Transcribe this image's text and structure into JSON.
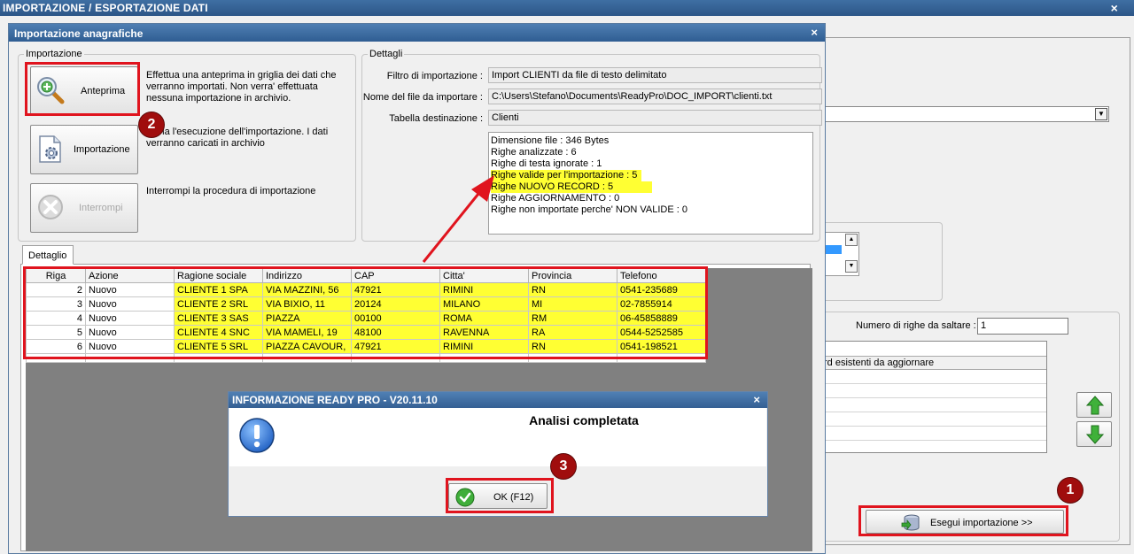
{
  "main_window": {
    "title": "IMPORTAZIONE / ESPORTAZIONE DATI",
    "skip_rows_label": "Numero di righe da saltare  :",
    "skip_rows_value": "1",
    "update_records_header": "rd esistenti da aggiornare",
    "execute_button_label": "Esegui importazione >>"
  },
  "dialog": {
    "title": "Importazione anagrafiche",
    "import_group_label": "Importazione",
    "preview_button_label": "Anteprima",
    "preview_description": "Effettua una anteprima in griglia dei dati che verranno importati. Non verra' effettuata nessuna importazione in archivio.",
    "import_button_label": "Importazione",
    "import_description": "Avvia l'esecuzione dell'importazione. I dati verranno caricati in archivio",
    "stop_button_label": "Interrompi",
    "stop_description": "Interrompi la procedura di importazione",
    "details_group_label": "Dettagli",
    "filter_label": "Filtro di importazione :",
    "filter_value": "Import CLIENTI da file di testo delimitato",
    "file_label": "Nome del file da importare :",
    "file_value": "C:\\Users\\Stefano\\Documents\\ReadyPro\\DOC_IMPORT\\clienti.txt",
    "table_label": "Tabella destinazione :",
    "table_value": "Clienti",
    "summary": [
      "Dimensione file : 346 Bytes",
      "Righe analizzate : 6",
      "Righe di testa ignorate : 1",
      "Righe valide per l'importazione : 5",
      "Righe NUOVO RECORD : 5",
      "Righe AGGIORNAMENTO  : 0",
      "Righe non importate perche' NON VALIDE : 0"
    ],
    "tab_label": "Dettaglio",
    "grid": {
      "columns": [
        "Riga",
        "Azione",
        "Ragione sociale",
        "Indirizzo",
        "CAP",
        "Citta'",
        "Provincia",
        "Telefono"
      ],
      "rows": [
        [
          "2",
          "Nuovo",
          "CLIENTE 1 SPA",
          "VIA MAZZINI, 56",
          "47921",
          "RIMINI",
          "RN",
          "0541-235689"
        ],
        [
          "3",
          "Nuovo",
          "CLIENTE 2 SRL",
          "VIA BIXIO, 11",
          "20124",
          "MILANO",
          "MI",
          "02-7855914"
        ],
        [
          "4",
          "Nuovo",
          "CLIENTE 3 SAS",
          "PIAZZA",
          "00100",
          "ROMA",
          "RM",
          "06-45858889"
        ],
        [
          "5",
          "Nuovo",
          "CLIENTE 4 SNC",
          "VIA MAMELI, 19",
          "48100",
          "RAVENNA",
          "RA",
          "0544-5252585"
        ],
        [
          "6",
          "Nuovo",
          "CLIENTE 5 SRL",
          "PIAZZA CAVOUR,",
          "47921",
          "RIMINI",
          "RN",
          "0541-198521"
        ]
      ]
    }
  },
  "message_box": {
    "title": "INFORMAZIONE READY PRO - V20.11.10",
    "message": "Analisi completata",
    "ok_label": "OK (F12)"
  },
  "badges": {
    "one": "1",
    "two": "2",
    "three": "3"
  },
  "colors": {
    "annotation_red": "#e0141e",
    "highlight_yellow": "#ffff33",
    "titlebar_blue": "#2f5d92",
    "badge_red": "#a00d0d"
  }
}
